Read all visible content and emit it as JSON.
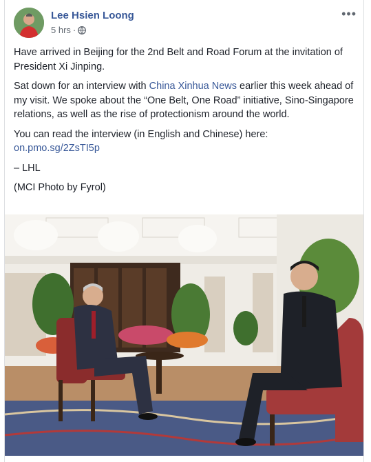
{
  "post": {
    "author": "Lee Hsien Loong",
    "timestamp": "5 hrs",
    "separator": "·",
    "privacy_icon": "globe-icon",
    "more_icon": "•••",
    "paragraphs": {
      "p1": "Have arrived in Beijing for the 2nd Belt and Road Forum at the invitation of President Xi Jinping.",
      "p2_before": "Sat down for an interview with ",
      "p2_link": "China Xinhua News",
      "p2_after": " earlier this week ahead of my visit. We spoke about the “One Belt, One Road” initiative, Sino-Singapore relations, as well as the rise of protectionism around the world.",
      "p3": "You can read the interview (in English and Chinese) here:",
      "p3_link": "on.pmo.sg/2ZsTI5p",
      "p4": "– LHL",
      "p5": "(MCI Photo by Fyrol)"
    }
  },
  "colors": {
    "link": "#385898",
    "meta": "#606770",
    "text": "#1d2129",
    "border": "#dddfe2"
  }
}
